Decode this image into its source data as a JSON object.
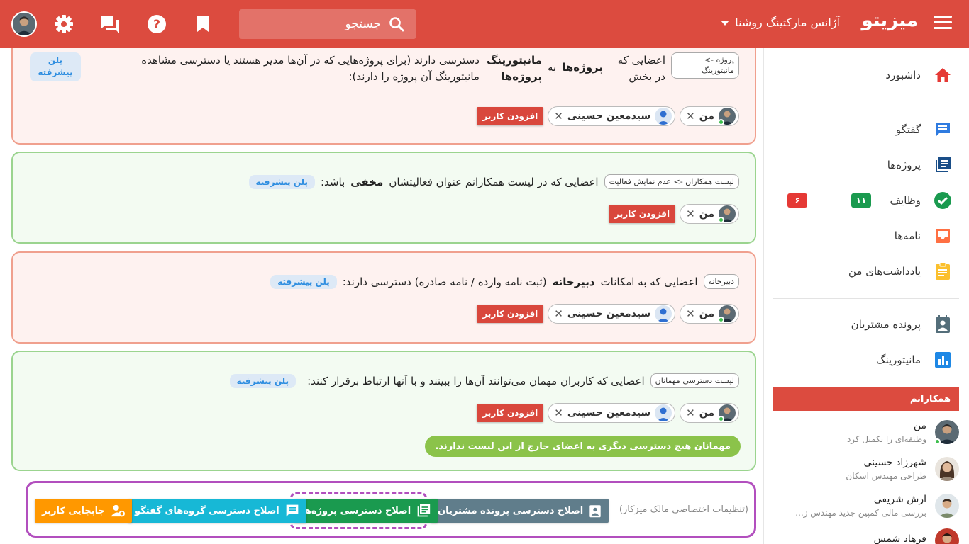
{
  "topbar": {
    "brand": "میزیتو",
    "org": "آژانس مارکتینگ روشنا",
    "search_placeholder": "جستجو",
    "icons": [
      "bookmark-icon",
      "help-icon",
      "chat-icon",
      "gear-icon"
    ],
    "accent": "#dc4b3f"
  },
  "sidebar": {
    "items": [
      {
        "label": "داشبورد",
        "icon": "home-icon"
      },
      {
        "label": "گفتگو",
        "icon": "chat-icon"
      },
      {
        "label": "پروژه‌ها",
        "icon": "projects-icon"
      },
      {
        "label": "وظایف",
        "icon": "check-icon",
        "badges": [
          "۱۱",
          "۶"
        ]
      },
      {
        "label": "نامه‌ها",
        "icon": "inbox-icon"
      },
      {
        "label": "یادداشت‌های من",
        "icon": "notes-icon"
      },
      {
        "label": "پرونده مشتریان",
        "icon": "contact-icon"
      },
      {
        "label": "مانیتورینگ",
        "icon": "chart-icon"
      }
    ],
    "colleagues_title": "همکارانم",
    "colleagues": [
      {
        "name": "من",
        "sub": "وظیفه‌ای را تکمیل کرد"
      },
      {
        "name": "شهرزاد حسینی",
        "sub": "طراحی مهندس اشکان"
      },
      {
        "name": "آرش شریفی",
        "sub": "بررسی مالی کمپین جدید مهندس ز..."
      },
      {
        "name": "فرهاد شمس",
        "sub": ""
      }
    ]
  },
  "cards": [
    {
      "tag": "پروژه -> مانیتورینگ",
      "text_a": "اعضایی که در بخش",
      "bold_a": "پروژه‌ها",
      "text_b": "به",
      "bold_b": "مانیتورینگ پروژه‌ها",
      "text_c": "دسترسی دارند (برای پروژه‌هایی که در آن‌ها مدیر هستند یا دسترسی مشاهده مانیتورینگ آن پروژه را دارند):",
      "plan": "پلن پیشرفته",
      "users": [
        "من",
        "سیدمعین حسینی"
      ],
      "add": "افزودن کاربر"
    },
    {
      "tag": "لیست همکاران -> عدم نمایش فعالیت",
      "text_a": "اعضایی که در لیست همکارانم عنوان فعالیتشان",
      "bold_a": "مخفی",
      "text_b": "باشد:",
      "plan": "پلن پیشرفته",
      "users": [
        "من"
      ],
      "add": "افزودن کاربر"
    },
    {
      "tag": "دبیرخانه",
      "text_a": "اعضایی که به امکانات",
      "bold_a": "دبیرخانه",
      "text_b": "(ثبت نامه وارده / نامه صادره) دسترسی دارند:",
      "plan": "پلن پیشرفته",
      "users": [
        "من",
        "سیدمعین حسینی"
      ],
      "add": "افزودن کاربر"
    },
    {
      "tag": "لیست دسترسی مهمانان",
      "text_a": "اعضایی که کاربران مهمان می‌توانند آن‌ها را ببینند و با آنها ارتباط برقرار کنند:",
      "plan": "پلن پیشرفته",
      "users": [
        "من",
        "سیدمعین حسینی"
      ],
      "add": "افزودن کاربر",
      "note": "مهمانان هیچ دسترسی دیگری به اعضای خارج از این لیست ندارند."
    }
  ],
  "owner": {
    "label": "(تنظیمات اختصاصی مالک میزکار)",
    "buttons": [
      {
        "label": "اصلاح دسترسی پرونده مشتریان",
        "color": "#607d8b",
        "icon": "contact-icon"
      },
      {
        "label": "اصلاح دسترسی پروژه‌ها",
        "color": "#1a9a4f",
        "icon": "projects-icon"
      },
      {
        "label": "اصلاح دسترسی گروه‌های گفتگو",
        "color": "#17b8d6",
        "icon": "chat-icon"
      },
      {
        "label": "جابجایی کاربر",
        "color": "#ff9800",
        "icon": "user-settings-icon"
      }
    ]
  }
}
